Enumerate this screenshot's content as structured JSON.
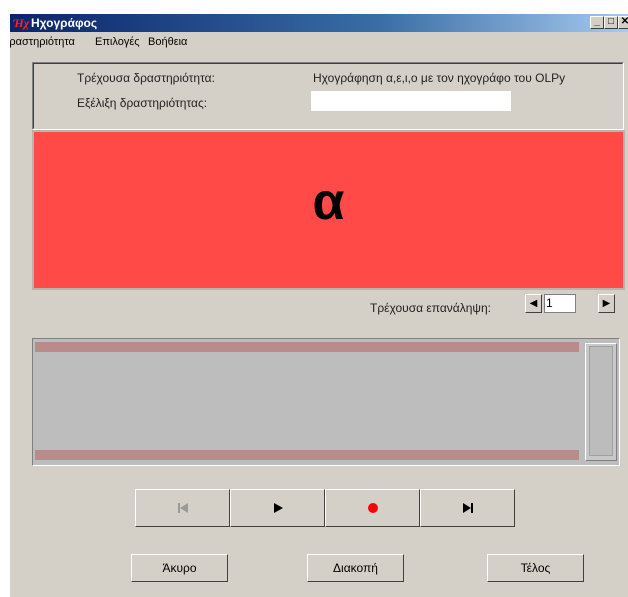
{
  "window": {
    "title": "Ηχογράφος",
    "app_icon_text": "Ήχ"
  },
  "menu": [
    "Δραστηριότητα",
    "Επιλογές",
    "Βοήθεια"
  ],
  "info": {
    "current_activity_label": "Τρέχουσα δραστηριότητα:",
    "current_activity_value": "Ηχογράφηση α,ε,ι,ο με τον ηχογράφο του OLPy",
    "progress_label": "Εξέλιξη δραστηριότητας:",
    "progress_value": ""
  },
  "stimulus": {
    "letter": "α",
    "background_color": "#ff4a48"
  },
  "repetition": {
    "label": "Τρέχουσα επανάληψη:",
    "value": "1"
  },
  "transport": {
    "first": "skip-back-icon",
    "play": "play-icon",
    "record": "record-icon",
    "last": "skip-forward-icon",
    "record_color": "#ff0000"
  },
  "buttons": {
    "cancel": "Άκυρο",
    "stop": "Διακοπή",
    "finish": "Τέλος"
  }
}
